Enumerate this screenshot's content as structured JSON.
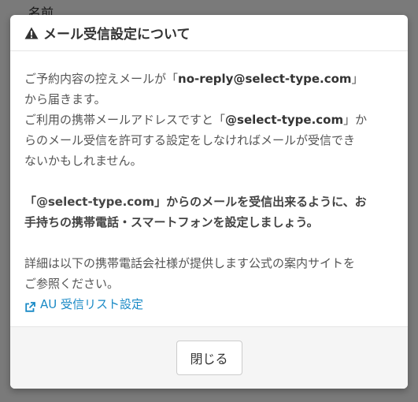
{
  "background": {
    "label": "名前"
  },
  "modal": {
    "title": "メール受信設定について",
    "title_icon": "warning-icon",
    "para1": {
      "line1_prefix": "ご予約内容の控えメールが「",
      "email": "no-reply@select-type.com",
      "line1_suffix": "」",
      "line2": "から届きます。",
      "line3_prefix": "ご利用の携帯メールアドレスですと「",
      "domain": "@select-type.com",
      "line3_suffix": "」か",
      "line4": "らのメール受信を許可する設定をしなければメールが受信でき",
      "line5": "ないかもしれません。"
    },
    "para2": {
      "line1": "「@select-type.com」からのメールを受信出来るように、お",
      "line2": "手持ちの携帯電話・スマートフォンを設定しましょう。"
    },
    "para3": {
      "line1": "詳細は以下の携帯電話会社様が提供します公式の案内サイトを",
      "line2": "ご参照ください。",
      "link_label": "AU 受信リスト設定",
      "link_icon": "external-link-icon"
    },
    "close_label": "閉じる"
  },
  "colors": {
    "link": "#1a8ac6",
    "text": "#555555",
    "title": "#333333"
  }
}
